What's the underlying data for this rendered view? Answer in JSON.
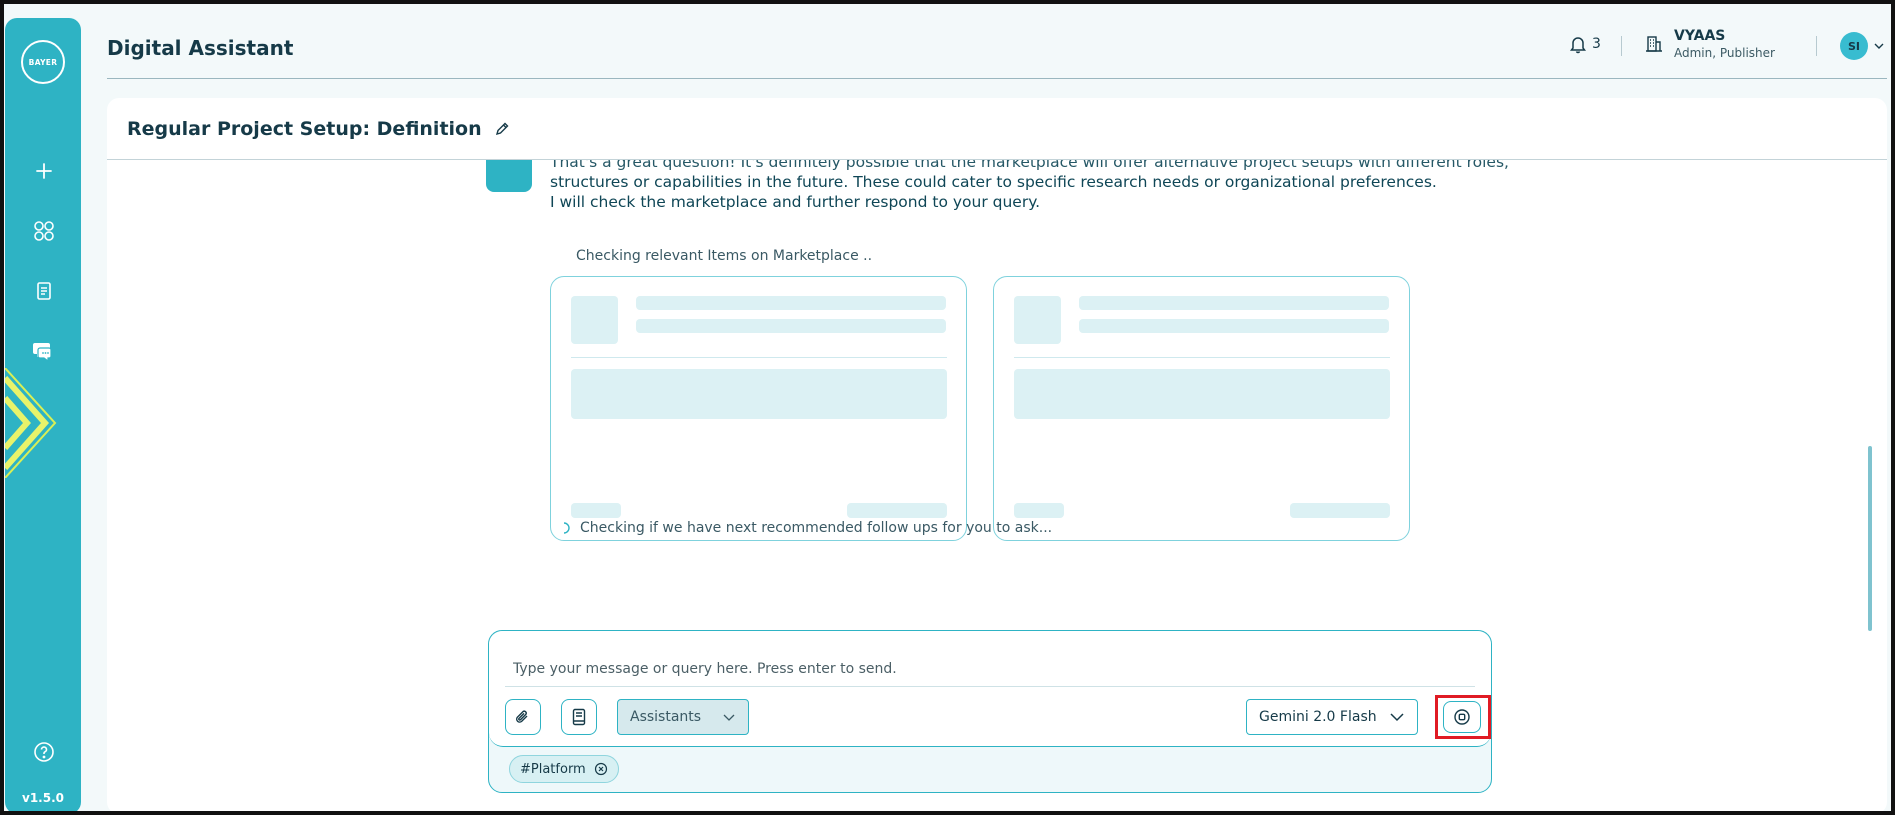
{
  "sidebar": {
    "logo_text_horizontal": "BAYER",
    "logo_text_vertical": "BAYER",
    "version": "v1.5.0"
  },
  "header": {
    "app_title": "Digital Assistant",
    "notification_count": "3",
    "org_name": "VYAAS",
    "org_role": "Admin, Publisher",
    "avatar_initials": "SI"
  },
  "project": {
    "title": "Regular Project Setup: Definition"
  },
  "chat": {
    "message_line_1": "That's a great question! It's definitely possible that the marketplace will offer alternative project setups with different roles,",
    "message_line_2": "structures or capabilities in the future. These could cater to specific research needs or organizational preferences.",
    "message_line_3": "I will check the marketplace and further respond to your query.",
    "status_marketplace": "Checking relevant Items on Marketplace ..",
    "status_followups": "Checking if we have next recommended follow ups for you to ask..."
  },
  "composer": {
    "placeholder": "Type your message or query here. Press enter to send.",
    "assistants_label": "Assistants",
    "model_label": "Gemini 2.0 Flash",
    "tag_label": "#Platform"
  },
  "colors": {
    "accent": "#2eb3c4",
    "highlight": "#e01b24"
  }
}
